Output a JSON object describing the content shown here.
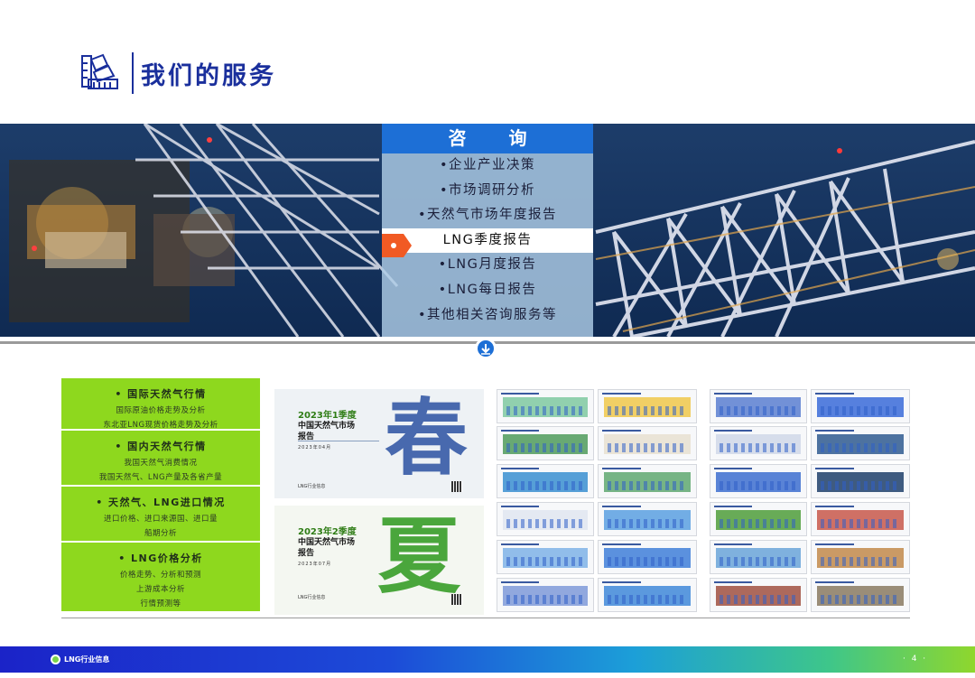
{
  "header": {
    "title": "我们的服务"
  },
  "consult": {
    "title": "咨 询",
    "items": [
      {
        "label": "•企业产业决策",
        "active": false
      },
      {
        "label": "•市场调研分析",
        "active": false
      },
      {
        "label": "•天然气市场年度报告",
        "active": false
      },
      {
        "label": "LNG季度报告",
        "active": true
      },
      {
        "label": "•LNG月度报告",
        "active": false
      },
      {
        "label": "•LNG每日报告",
        "active": false
      },
      {
        "label": "•其他相关咨询服务等",
        "active": false
      }
    ]
  },
  "categories": [
    {
      "title": "• 国际天然气行情",
      "lines": [
        "国际原油价格走势及分析",
        "东北亚LNG现货价格走势及分析"
      ]
    },
    {
      "title": "• 国内天然气行情",
      "lines": [
        "我国天然气消费情况",
        "我国天然气、LNG产量及各省产量"
      ]
    },
    {
      "title": "• 天然气、LNG进口情况",
      "lines": [
        "进口价格、进口来源国、进口量",
        "船期分析"
      ]
    },
    {
      "title": "• LNG价格分析",
      "lines": [
        "价格走势、分析和预测",
        "上游成本分析",
        "行情预测等"
      ]
    }
  ],
  "covers": [
    {
      "year": "2023年1季度",
      "title1": "中国天然气市场",
      "title2": "报告",
      "date": "2023年04月",
      "brand": "LNG行业信息",
      "char": "春"
    },
    {
      "year": "2023年2季度",
      "title1": "中国天然气市场",
      "title2": "报告",
      "date": "2023年07月",
      "brand": "LNG行业信息",
      "char": "夏"
    }
  ],
  "footer": {
    "brand": "LNG行业信息",
    "page": "· 4 ·"
  },
  "colors": {
    "brand_blue": "#1a2f9c",
    "menu_blue": "#1d6fd6",
    "green": "#8ed81e",
    "accent_orange": "#f15a24"
  }
}
